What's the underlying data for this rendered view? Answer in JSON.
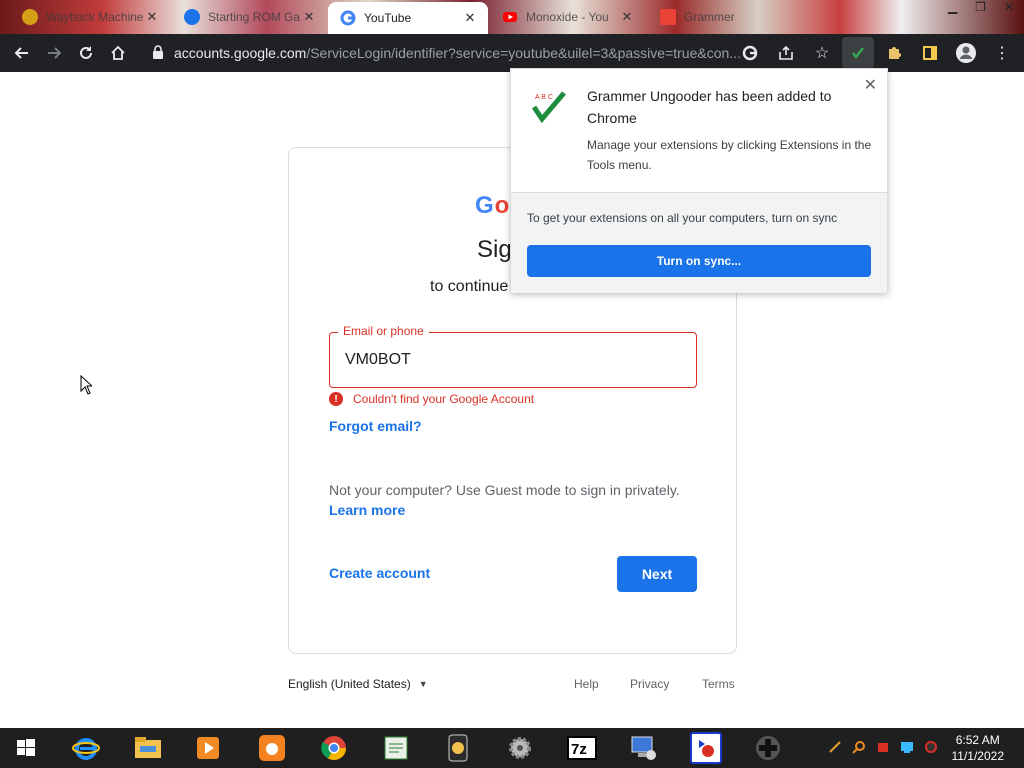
{
  "browser": {
    "tabs": [
      {
        "title": "Wayback Machine",
        "favicon": "wayback-icon",
        "favicon_color": "#d4a017",
        "active": false
      },
      {
        "title": "Starting ROM Ga",
        "favicon": "chrome-c-icon",
        "favicon_color": "#1a73e8",
        "active": false
      },
      {
        "title": "YouTube",
        "favicon": "google-g-icon",
        "favicon_color": "#4285f4",
        "active": true
      },
      {
        "title": "Monoxide - You",
        "favicon": "youtube-icon",
        "favicon_color": "#ff0000",
        "active": false
      },
      {
        "title": "Grammer",
        "favicon": "gmail-icon",
        "favicon_color": "#ea4335",
        "active": false
      }
    ],
    "address_bar": {
      "host": "accounts.google.com",
      "path": "/ServiceLogin/identifier?service=youtube&uilel=3&passive=true&con..."
    }
  },
  "signin": {
    "logo_text": "Goo",
    "title": "Sig",
    "subtitle": "to continue",
    "email_label": "Email or phone",
    "email_value": "VM0BOT",
    "error_text": "Couldn't find your Google Account",
    "forgot_email": "Forgot email?",
    "guest_text": "Not your computer? Use Guest mode to sign in privately.",
    "learn_more": "Learn more",
    "create_account": "Create account",
    "next_button": "Next"
  },
  "footer": {
    "language": "English (United States)",
    "help": "Help",
    "privacy": "Privacy",
    "terms": "Terms"
  },
  "extension_popup": {
    "title": "Grammer Ungooder has been added to Chrome",
    "description": "Manage your extensions by clicking Extensions in the Tools menu.",
    "sync_text": "To get your extensions on all your computers, turn on sync",
    "sync_button": "Turn on sync..."
  },
  "taskbar": {
    "time": "6:52 AM",
    "date": "11/1/2022"
  },
  "colors": {
    "accent_blue": "#1a73e8",
    "error_red": "#d93025",
    "toolbar_dark": "#202124"
  }
}
